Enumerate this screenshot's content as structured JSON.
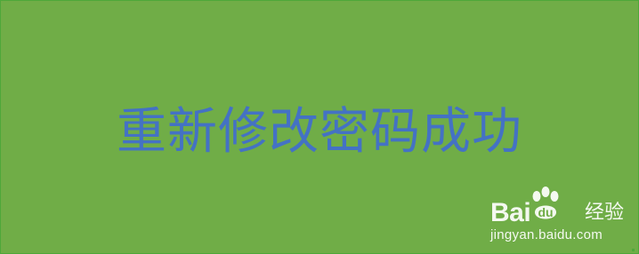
{
  "slide": {
    "message": "重新修改密码成功",
    "background_color": "#70ad47",
    "text_color": "#4472c4"
  },
  "watermark": {
    "logo_text": "Baidu经验",
    "logo_icon": "paw-icon",
    "url": "jingyan.baidu.com"
  }
}
